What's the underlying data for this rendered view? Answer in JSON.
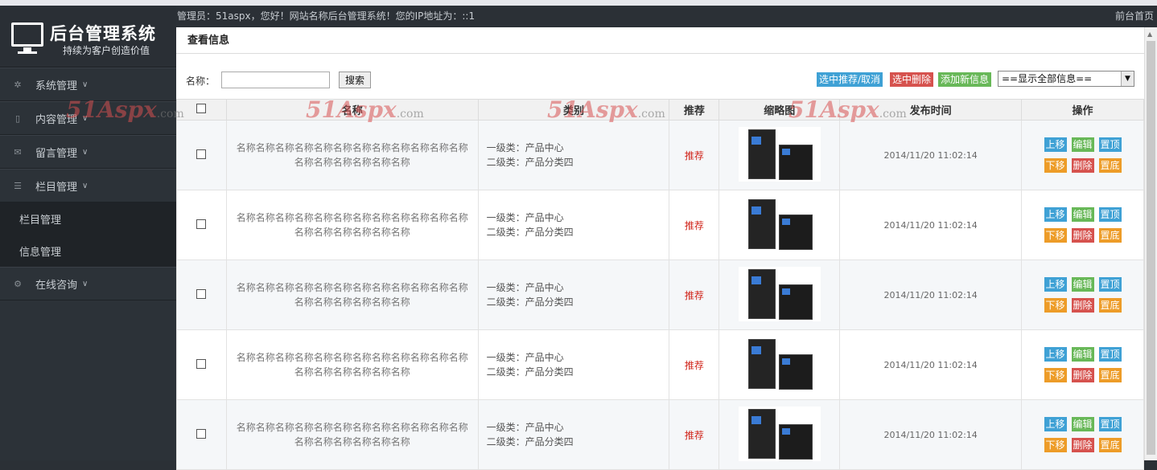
{
  "sidebar": {
    "logo_title": "后台管理系统",
    "logo_subtitle": "持续为客户创造价值",
    "menu": [
      {
        "label": "系统管理",
        "chev": "∨",
        "icon": "gear-icon"
      },
      {
        "label": "内容管理",
        "chev": "∨",
        "icon": "document-icon"
      },
      {
        "label": "留言管理",
        "chev": "∨",
        "icon": "mail-icon"
      },
      {
        "label": "栏目管理",
        "chev": "∨",
        "icon": "list-icon"
      }
    ],
    "submenu": [
      "栏目管理",
      "信息管理"
    ],
    "last_menu": {
      "label": "在线咨询",
      "chev": "∨",
      "icon": "gears-icon"
    }
  },
  "topbar": {
    "welcome": "管理员：51aspx，您好！网站名称后台管理系统！您的IP地址为：::1",
    "front_link": "前台首页"
  },
  "page": {
    "title": "查看信息",
    "search_label": "名称：",
    "search_value": "",
    "search_button": "搜索",
    "btn_recommend": "选中推荐/取消",
    "btn_delete": "选中删除",
    "btn_add": "添加新信息",
    "filter_selected": "==显示全部信息=="
  },
  "table": {
    "headers": [
      "名称",
      "类别",
      "推荐",
      "缩略图",
      "发布时间",
      "操作"
    ],
    "rows": [
      {
        "name": "名称名称名称名称名称名称名称名称名称名称名称名称名称名称名称名称名称名称",
        "cat1": "一级类：产品中心",
        "cat2": "二级类：产品分类四",
        "rec": "推荐",
        "date": "2014/11/20 11:02:14"
      },
      {
        "name": "名称名称名称名称名称名称名称名称名称名称名称名称名称名称名称名称名称名称",
        "cat1": "一级类：产品中心",
        "cat2": "二级类：产品分类四",
        "rec": "推荐",
        "date": "2014/11/20 11:02:14"
      },
      {
        "name": "名称名称名称名称名称名称名称名称名称名称名称名称名称名称名称名称名称名称",
        "cat1": "一级类：产品中心",
        "cat2": "二级类：产品分类四",
        "rec": "推荐",
        "date": "2014/11/20 11:02:14"
      },
      {
        "name": "名称名称名称名称名称名称名称名称名称名称名称名称名称名称名称名称名称名称",
        "cat1": "一级类：产品中心",
        "cat2": "二级类：产品分类四",
        "rec": "推荐",
        "date": "2014/11/20 11:02:14"
      },
      {
        "name": "名称名称名称名称名称名称名称名称名称名称名称名称名称名称名称名称名称名称",
        "cat1": "一级类：产品中心",
        "cat2": "二级类：产品分类四",
        "rec": "推荐",
        "date": "2014/11/20 11:02:14"
      }
    ],
    "ops": {
      "up": "上移",
      "edit": "编辑",
      "top": "置顶",
      "down": "下移",
      "del": "删除",
      "bottom": "置底"
    }
  },
  "watermark": {
    "text": "51Aspx",
    "suffix": ".com"
  }
}
